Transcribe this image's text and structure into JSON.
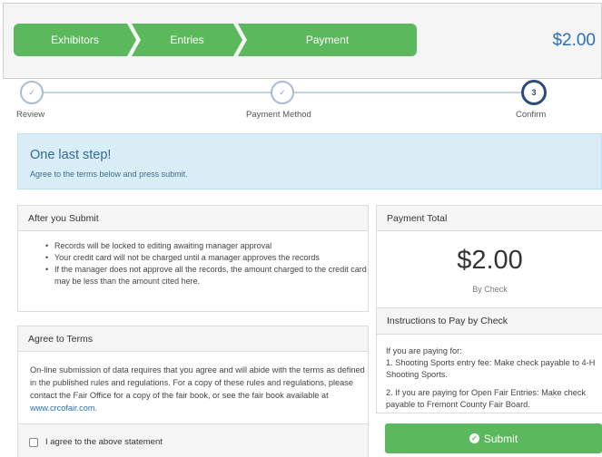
{
  "header": {
    "breadcrumb": [
      "Exhibitors",
      "Entries",
      "Payment"
    ],
    "total": "$2.00"
  },
  "stepper": {
    "steps": [
      {
        "label": "Review",
        "marker": "✓"
      },
      {
        "label": "Payment Method",
        "marker": "✓"
      },
      {
        "label": "Confirm",
        "marker": "3"
      }
    ]
  },
  "notice": {
    "title": "One last step!",
    "text": "Agree to the terms below and press submit."
  },
  "after_submit": {
    "title": "After you Submit",
    "items": [
      "Records will be locked to editing awaiting manager approval",
      "Your credit card will not be charged until a manager approves the records",
      "If the manager does not approve all the records, the amount charged to the credit card may be less than the amount cited here."
    ]
  },
  "agree_terms": {
    "title": "Agree to Terms",
    "text": "On-line submission of data requires that you agree and will abide with the terms as defined in the published rules and regulations. For a copy of these rules and regulations, please contact the Fair Office for a copy of the fair book, or see the fair book available at",
    "link": "www.crcofair.com.",
    "checkbox_label": "I agree to the above statement"
  },
  "payment_total": {
    "title": "Payment Total",
    "amount": "$2.00",
    "method": "By Check",
    "instructions_title": "Instructions to Pay by Check",
    "instructions": [
      "If you are paying for:",
      "1. Shooting Sports entry fee: Make check payable to 4-H Shooting Sports.",
      "2. If you are paying for Open Fair Entries: Make check payable to Fremont County Fair Board."
    ]
  },
  "submit": {
    "label": "Submit"
  },
  "colors": {
    "green": "#5cb85c",
    "blue": "#2a6fb5",
    "info_bg": "#d9edf7"
  }
}
